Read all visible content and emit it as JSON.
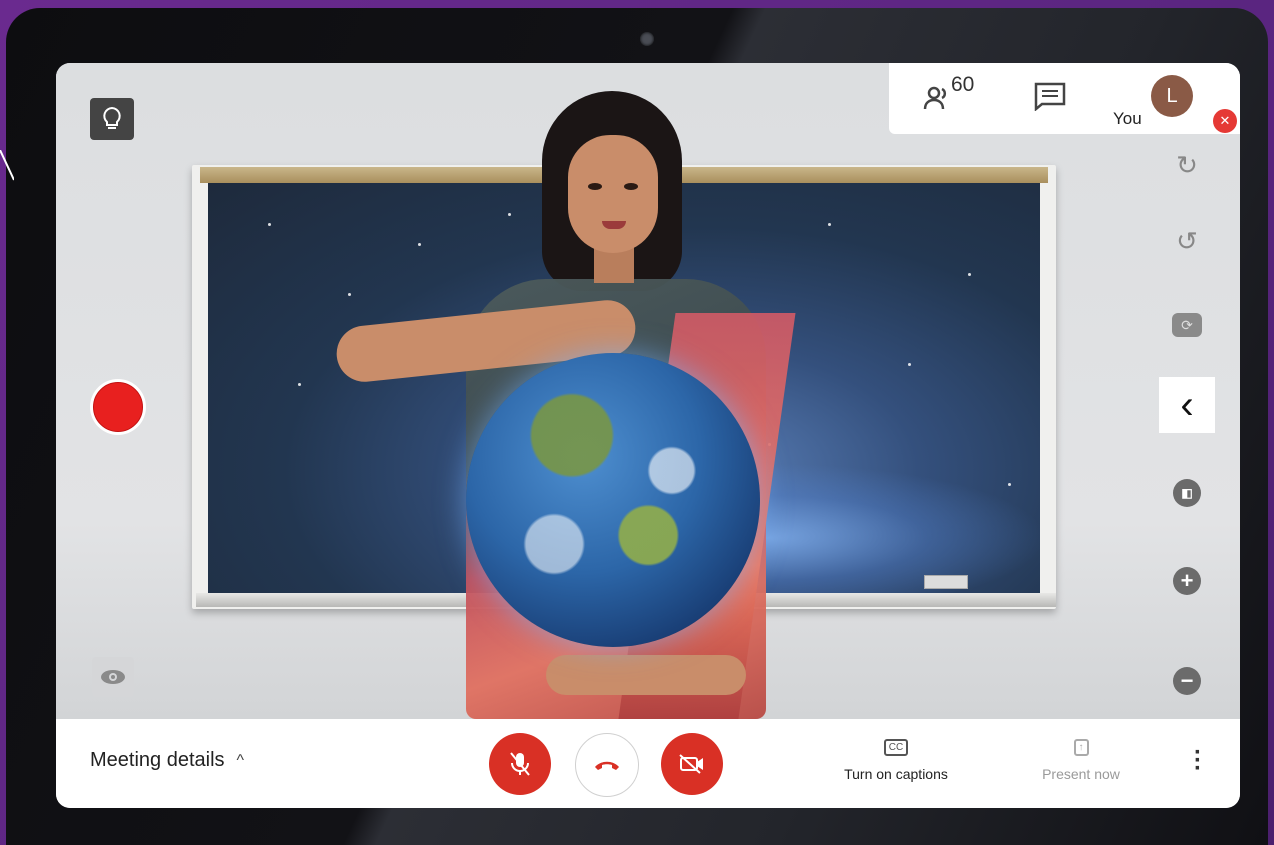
{
  "top_panel": {
    "participants_icon": "people-icon",
    "participants_count": "60",
    "chat_icon": "chat-icon",
    "you_label": "You",
    "avatar_initial": "L",
    "mute_icon": "mic-off-icon"
  },
  "left_controls": {
    "bulb_icon": "lightbulb-icon",
    "record_icon": "record-icon",
    "eye_icon": "eye-icon"
  },
  "right_toolbar": [
    "redo-icon",
    "undo-icon",
    "camera-switch-icon",
    "chevron-left-icon",
    "toggle-icon",
    "zoom-in-icon",
    "zoom-out-icon"
  ],
  "bottom_bar": {
    "meeting_details": "Meeting details",
    "caret_icon": "chevron-up-icon",
    "mic_off_icon": "mic-off-icon",
    "end_call_icon": "phone-hangup-icon",
    "camera_off_icon": "camera-off-icon",
    "captions_icon_text": "CC",
    "captions_label": "Turn on captions",
    "present_icon": "present-icon",
    "present_label": "Present now",
    "more_icon": "more-vert-icon"
  },
  "colors": {
    "record": "#e8201f",
    "danger": "#d93025",
    "background": "#5a2580"
  }
}
